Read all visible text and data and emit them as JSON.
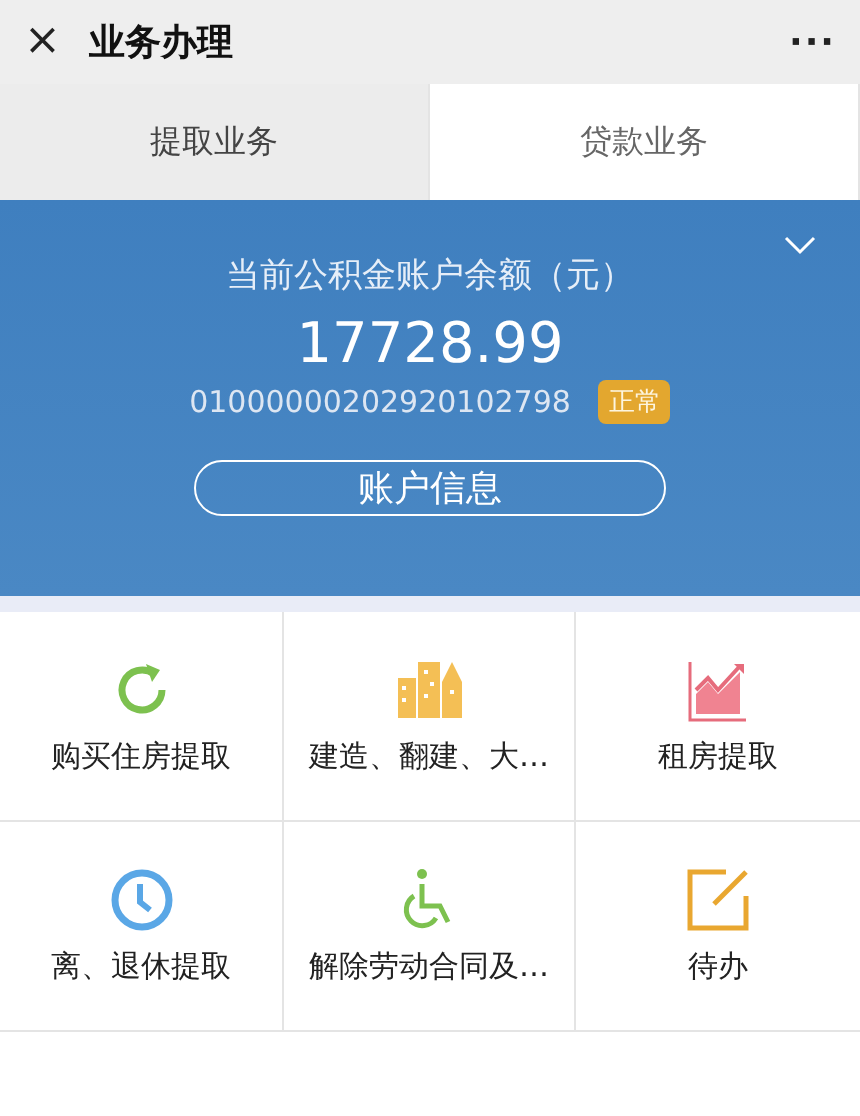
{
  "header": {
    "close": "×",
    "title": "业务办理",
    "more": "···"
  },
  "tabs": [
    {
      "label": "提取业务",
      "selected": true
    },
    {
      "label": "贷款业务",
      "selected": false
    }
  ],
  "account": {
    "caption": "当前公积金账户余额（元）",
    "balance": "17728.99",
    "number": "01000000202920102798",
    "status": "正常",
    "button": "账户信息",
    "expanded": false
  },
  "services": [
    {
      "label": "购买住房提取",
      "kind": "refresh"
    },
    {
      "label": "建造、翻建、大…",
      "kind": "buildings"
    },
    {
      "label": "租房提取",
      "kind": "chart"
    },
    {
      "label": "离、退休提取",
      "kind": "clock"
    },
    {
      "label": "解除劳动合同及…",
      "kind": "wheelchair"
    },
    {
      "label": "待办",
      "kind": "edit"
    }
  ]
}
